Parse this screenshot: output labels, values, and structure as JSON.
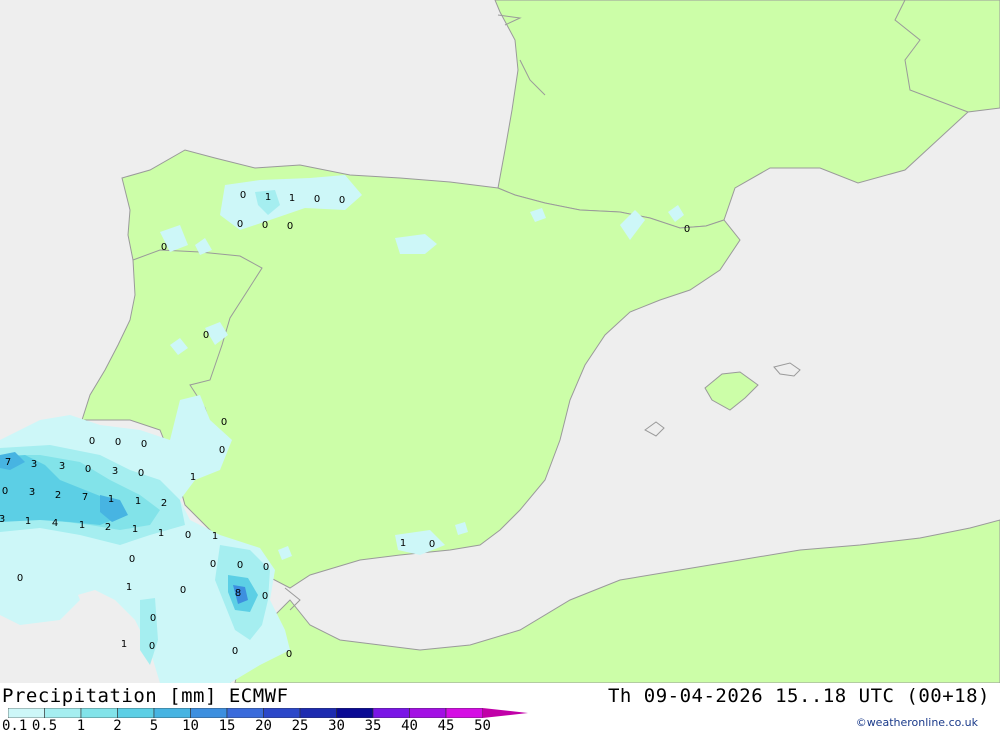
{
  "header": {
    "title": "Precipitation [mm] ECMWF",
    "datetime": "Th 09-04-2026 15..18 UTC (00+18)",
    "credit": "©weatheronline.co.uk"
  },
  "legend": {
    "ticks": [
      "0.1",
      "0.5",
      "1",
      "2",
      "5",
      "10",
      "15",
      "20",
      "25",
      "30",
      "35",
      "40",
      "45",
      "50"
    ],
    "colors": [
      "#cdf7f8",
      "#a5eef0",
      "#82e3e9",
      "#5ccfe5",
      "#47b4e2",
      "#3d8fdf",
      "#3a6bdb",
      "#2c48c9",
      "#1d2bb0",
      "#0a0a94",
      "#7a16e6",
      "#a310e4",
      "#d50ee4",
      "#e60ae4",
      "#c100a8",
      "#9c008c"
    ]
  },
  "colors": {
    "sea": "#eeeeee",
    "land": "#ccfea8",
    "border": "#9a9a9a",
    "precip_light": "#cdf7f8",
    "precip_mid": "#a5eef0",
    "precip_heavy": "#5ccfe5"
  },
  "map_labels": [
    "0",
    "1",
    "1",
    "0",
    "0",
    "0",
    "0",
    "0",
    "0",
    "0",
    "0",
    "0",
    "0",
    "0",
    "0",
    "0",
    "7",
    "3",
    "3",
    "0",
    "3",
    "0",
    "1",
    "0",
    "3",
    "2",
    "7",
    "1",
    "1",
    "2",
    "3",
    "1",
    "4",
    "1",
    "2",
    "1",
    "1",
    "0",
    "1",
    "0",
    "0",
    "0",
    "0",
    "0",
    "8",
    "0",
    "1",
    "0",
    "0",
    "1",
    "0",
    "0",
    "0",
    "1",
    "0"
  ]
}
